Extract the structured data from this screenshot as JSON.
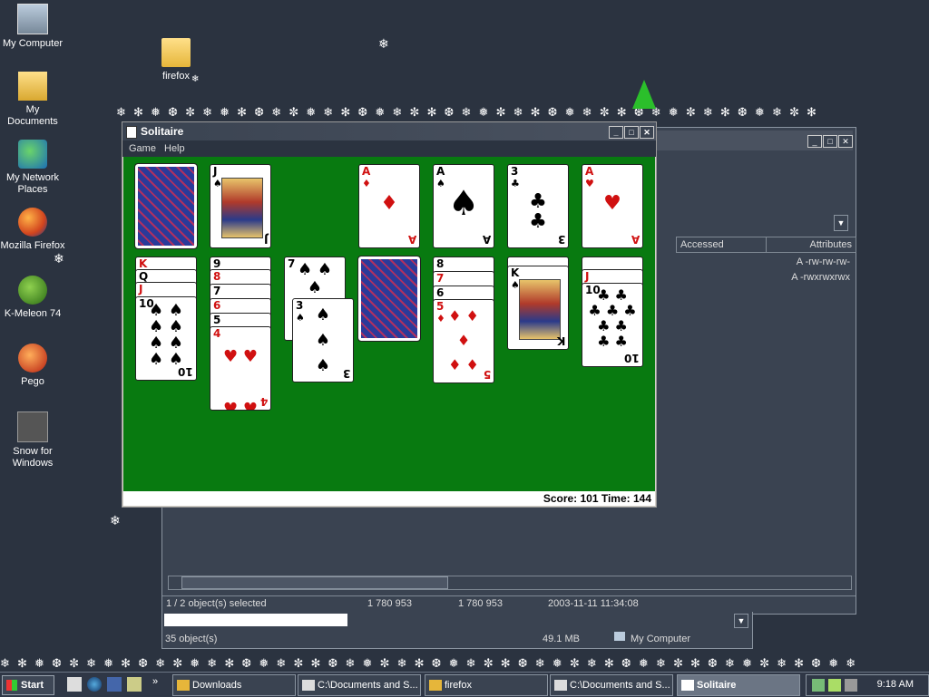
{
  "desktop": {
    "icons": [
      {
        "label": "My Computer",
        "icon": "computer-icon"
      },
      {
        "label": "My Documents",
        "icon": "documents-folder-icon"
      },
      {
        "label": "My Network Places",
        "icon": "network-icon"
      },
      {
        "label": "Mozilla Firefox",
        "icon": "firefox-icon"
      },
      {
        "label": "K-Meleon 74",
        "icon": "kmeleon-icon"
      },
      {
        "label": "Pego",
        "icon": "pego-icon"
      },
      {
        "label": "Snow for Windows",
        "icon": "snow-icon"
      }
    ],
    "folder": {
      "label": "firefox",
      "icon": "folder-icon"
    }
  },
  "explorer": {
    "columns": [
      "Accessed",
      "Attributes"
    ],
    "attributes": [
      "A -rw-rw-rw-",
      "A -rwxrwxrwx"
    ],
    "status": {
      "selected": "1 / 2 object(s) selected",
      "size1": "1 780 953",
      "size2": "1 780 953",
      "date": "2003-11-11 11:34:08"
    },
    "status2": {
      "objects": "35 object(s)",
      "size": "49.1 MB",
      "location": "My Computer"
    }
  },
  "solitaire": {
    "title": "Solitaire",
    "menu": [
      "Game",
      "Help"
    ],
    "status": "Score: 101 Time: 144",
    "cards": {
      "waste": {
        "rank": "J",
        "suit": "♠"
      },
      "found1": {
        "rank": "A",
        "suit": "♦"
      },
      "found2": {
        "rank": "A",
        "suit": "♠"
      },
      "found3": {
        "rank": "3",
        "suit": "♣"
      },
      "found4": {
        "rank": "A",
        "suit": "♥"
      },
      "tab1": [
        "K",
        "Q",
        "J"
      ],
      "tab1_top": {
        "rank": "10",
        "suit": "♠"
      },
      "tab2": [
        "9",
        "8",
        "7",
        "6",
        "5"
      ],
      "tab2_top": {
        "rank": "4",
        "suit": "♥"
      },
      "tab3": {
        "rank": "7",
        "suit": "♠"
      },
      "drag": {
        "rank": "3",
        "suit": "♠"
      },
      "tab5": [
        "8",
        "7",
        "6"
      ],
      "tab5_top": {
        "rank": "5",
        "suit": "♦"
      },
      "tab6": {
        "rank": "K",
        "suit": "♠"
      },
      "tab7": [
        "J"
      ],
      "tab7_top": {
        "rank": "10",
        "suit": "♣"
      }
    }
  },
  "taskbar": {
    "start": "Start",
    "buttons": [
      {
        "label": "Downloads",
        "icon": "folder-icon"
      },
      {
        "label": "C:\\Documents and S...",
        "icon": "7zip-icon"
      },
      {
        "label": "firefox",
        "icon": "folder-icon"
      },
      {
        "label": "C:\\Documents and S...",
        "icon": "7zip-icon"
      },
      {
        "label": "Solitaire",
        "icon": "solitaire-icon"
      }
    ],
    "clock": "9:18 AM"
  },
  "colors": {
    "desktop": "#2b3340",
    "felt": "#087a10",
    "red_suit": "#d01010"
  }
}
